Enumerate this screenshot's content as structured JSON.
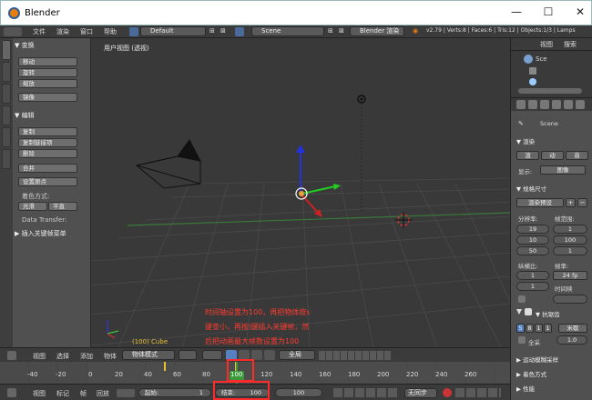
{
  "window": {
    "title": "Blender",
    "minimize": "—",
    "maximize": "☐",
    "close": "✕"
  },
  "menubar": {
    "items": [
      "文件",
      "渲染",
      "窗口",
      "帮助"
    ],
    "layout": "Default",
    "scene": "Scene",
    "engine": "Blender 渲染",
    "stats": "v2.79 | Verts:8 | Faces:6 | Tris:12 | Objects:1/3 | Lamps"
  },
  "toolshelf": {
    "tabs": [
      "工具",
      "创建",
      "关系",
      "动画",
      "物理",
      "蜡笔"
    ],
    "transform_header": "▼ 变换",
    "transform": [
      "移动",
      "旋转",
      "缩放"
    ],
    "mirror": "镜像",
    "edit_header": "▼ 编辑",
    "edit": [
      "复制",
      "复制链接项",
      "删除"
    ],
    "join": "合并",
    "origin": "设置原点",
    "shading_label": "着色方式:",
    "smooth": "光滑",
    "flat": "平直",
    "data_transfer": "Data Transfer:",
    "keyframe_header": "▶ 插入关键帧菜单"
  },
  "viewport": {
    "label": "用户视图 (透视)",
    "object_info": "(100) Cube",
    "annotation": [
      "时间轴设置为100，再把物体按s",
      "键变小，再按i键插入关键帧，然",
      "后把动画最大帧数设置为100"
    ]
  },
  "view_header": {
    "items": [
      "视图",
      "选择",
      "添加",
      "物体"
    ],
    "mode": "物体模式",
    "pivot": "全局"
  },
  "timeline": {
    "ticks": [
      "-40",
      "-20",
      "0",
      "20",
      "40",
      "60",
      "80",
      "100",
      "120",
      "140",
      "160",
      "180",
      "200",
      "220",
      "240",
      "260"
    ],
    "current_frame": "100"
  },
  "timeline_header": {
    "items": [
      "视图",
      "标记",
      "帧",
      "回放"
    ],
    "start_label": "起始:",
    "start_value": "1",
    "end_label": "结束:",
    "end_value": "100",
    "current": "100",
    "sync": "无同步"
  },
  "outliner": {
    "header_items": [
      "视图",
      "搜索"
    ],
    "scene": "Sce"
  },
  "properties": {
    "scene": "Scene",
    "render_header": "▼ 渲染",
    "render_btns": [
      "渲",
      "动",
      "音"
    ],
    "display_label": "显示:",
    "display_value": "图像",
    "dims_header": "▼ 规格尺寸",
    "preset": "渲染预设",
    "res_label": "分辨率:",
    "frame_label": "帧范围:",
    "res_x": "19",
    "res_y": "10",
    "res_pct": "50",
    "frame_start": "1",
    "frame_end": "100",
    "frame_step": "1",
    "aspect_label": "纵横比:",
    "fps_label": "帧率:",
    "fps": "24 fp",
    "aspect_x": "1",
    "aspect_y": "1",
    "time_remap": "时间映",
    "aa_header": "▼ 抗锯齿",
    "aa_values": [
      "5",
      "8",
      "1",
      "1"
    ],
    "filter": "米歇",
    "full": "全采",
    "full_value": "1.0",
    "motion_blur": "▶ 运动模糊采样",
    "shading": "▶ 着色方式",
    "perf": "▶ 性能"
  },
  "colors": {
    "accent": "#e87d0d",
    "red_box": "#ff2a2a",
    "x_axis": "#c33",
    "y_axis": "#3c3",
    "z_axis": "#33d"
  }
}
